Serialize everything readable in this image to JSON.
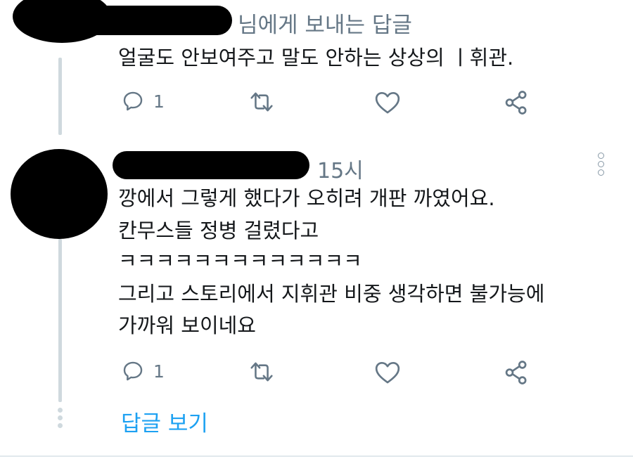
{
  "tweet1": {
    "reply_to": "님에게 보내는 답글",
    "text": "얼굴도 안보여주고 말도 안하는 상상의 ㅣ휘관.",
    "reply_count": "1"
  },
  "tweet2": {
    "time": "15시",
    "lines": [
      "깡에서 그렇게 했다가 오히려 개판 까였어요.",
      "칸무스들 정병 걸렸다고",
      "ㅋㅋㅋㅋㅋㅋㅋㅋㅋㅋㅋㅋㅋ",
      "그리고 스토리에서 지휘관 비중 생각하면 불가능에",
      "가까워 보이네요"
    ],
    "reply_count": "1"
  },
  "view_replies_label": "답글 보기",
  "colors": {
    "text": "#14171a",
    "secondary": "#657786",
    "link": "#1da1f2",
    "thread_line": "#cfd9de"
  },
  "icons": [
    "reply-icon",
    "retweet-icon",
    "like-icon",
    "share-icon",
    "more-options-icon"
  ]
}
